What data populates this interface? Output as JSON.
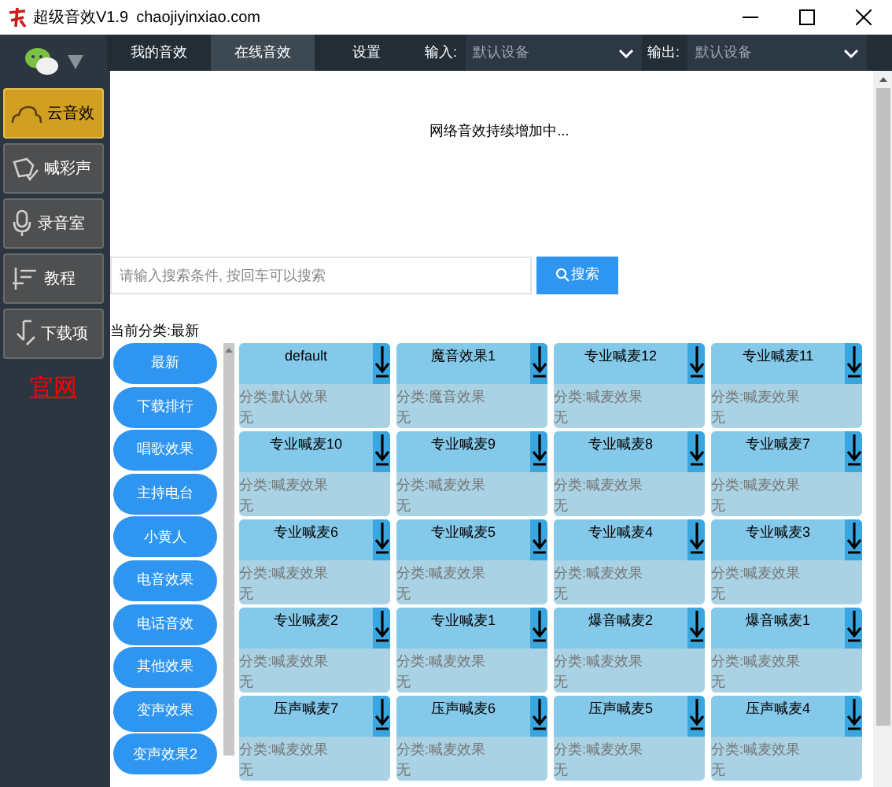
{
  "window": {
    "title": "超级音效V1.9",
    "url": "chaojiyinxiao.com"
  },
  "nav_tabs": [
    {
      "label": "我的音效",
      "selected": false
    },
    {
      "label": "在线音效",
      "selected": true
    },
    {
      "label": "设置",
      "selected": false
    }
  ],
  "devices": [
    {
      "label": "输入:",
      "value": "默认设备"
    },
    {
      "label": "输出:",
      "value": "默认设备"
    }
  ],
  "sidebar": {
    "items": [
      {
        "label": "云音效",
        "selected": true,
        "kind": "cloud"
      },
      {
        "label": "喊彩声",
        "selected": false,
        "kind": "mic-hand"
      },
      {
        "label": "录音室",
        "selected": false,
        "kind": "mic"
      },
      {
        "label": "教程",
        "selected": false,
        "kind": "doc"
      },
      {
        "label": "下载项",
        "selected": false,
        "kind": "download"
      }
    ],
    "link": "官网"
  },
  "notice": "网络音效持续增加中...",
  "search": {
    "placeholder": "请输入搜索条件, 按回车可以搜索",
    "button": "搜索"
  },
  "current_category": "当前分类:最新",
  "categories": [
    "最新",
    "下载排行",
    "唱歌效果",
    "主持电台",
    "小黄人",
    "电音效果",
    "电话音效",
    "其他效果",
    "变声效果",
    "变声效果2"
  ],
  "effects": [
    {
      "name": "default",
      "category": "分类:默认效果",
      "note": "无"
    },
    {
      "name": "魔音效果1",
      "category": "分类:魔音效果",
      "note": "无"
    },
    {
      "name": "专业喊麦12",
      "category": "分类:喊麦效果",
      "note": "无"
    },
    {
      "name": "专业喊麦11",
      "category": "分类:喊麦效果",
      "note": "无"
    },
    {
      "name": "专业喊麦10",
      "category": "分类:喊麦效果",
      "note": "无"
    },
    {
      "name": "专业喊麦9",
      "category": "分类:喊麦效果",
      "note": "无"
    },
    {
      "name": "专业喊麦8",
      "category": "分类:喊麦效果",
      "note": "无"
    },
    {
      "name": "专业喊麦7",
      "category": "分类:喊麦效果",
      "note": "无"
    },
    {
      "name": "专业喊麦6",
      "category": "分类:喊麦效果",
      "note": "无"
    },
    {
      "name": "专业喊麦5",
      "category": "分类:喊麦效果",
      "note": "无"
    },
    {
      "name": "专业喊麦4",
      "category": "分类:喊麦效果",
      "note": "无"
    },
    {
      "name": "专业喊麦3",
      "category": "分类:喊麦效果",
      "note": "无"
    },
    {
      "name": "专业喊麦2",
      "category": "分类:喊麦效果",
      "note": "无"
    },
    {
      "name": "专业喊麦1",
      "category": "分类:喊麦效果",
      "note": "无"
    },
    {
      "name": "爆音喊麦2",
      "category": "分类:喊麦效果",
      "note": "无"
    },
    {
      "name": "爆音喊麦1",
      "category": "分类:喊麦效果",
      "note": "无"
    },
    {
      "name": "压声喊麦7",
      "category": "分类:喊麦效果",
      "note": "无"
    },
    {
      "name": "压声喊麦6",
      "category": "分类:喊麦效果",
      "note": "无"
    },
    {
      "name": "压声喊麦5",
      "category": "分类:喊麦效果",
      "note": "无"
    },
    {
      "name": "压声喊麦4",
      "category": "分类:喊麦效果",
      "note": "无"
    }
  ]
}
